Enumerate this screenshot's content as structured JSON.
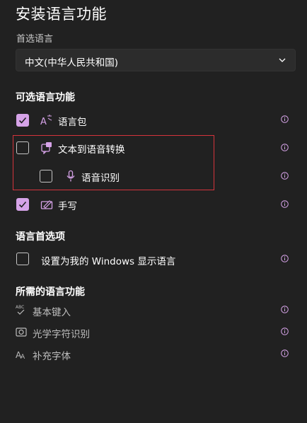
{
  "page": {
    "title": "安装语言功能",
    "preferred_label": "首选语言",
    "preferred_value": "中文(中华人民共和国)"
  },
  "optional": {
    "heading": "可选语言功能",
    "items": [
      {
        "label": "语言包",
        "checked": true,
        "icon": "language-pack-icon"
      },
      {
        "label": "文本到语音转换",
        "checked": false,
        "icon": "text-to-speech-icon"
      },
      {
        "label": "语音识别",
        "checked": false,
        "icon": "microphone-icon"
      },
      {
        "label": "手写",
        "checked": true,
        "icon": "handwriting-icon"
      }
    ]
  },
  "preferences": {
    "heading": "语言首选项",
    "display_label": "设置为我的 Windows 显示语言",
    "display_checked": false
  },
  "required": {
    "heading": "所需的语言功能",
    "items": [
      {
        "label": "基本键入",
        "icon": "abc-check-icon"
      },
      {
        "label": "光学字符识别",
        "icon": "ocr-camera-icon"
      },
      {
        "label": "补充字体",
        "icon": "font-icon"
      }
    ]
  },
  "colors": {
    "background": "#212121",
    "accent": "#d6a3e8",
    "highlight_border": "#d4343c"
  }
}
